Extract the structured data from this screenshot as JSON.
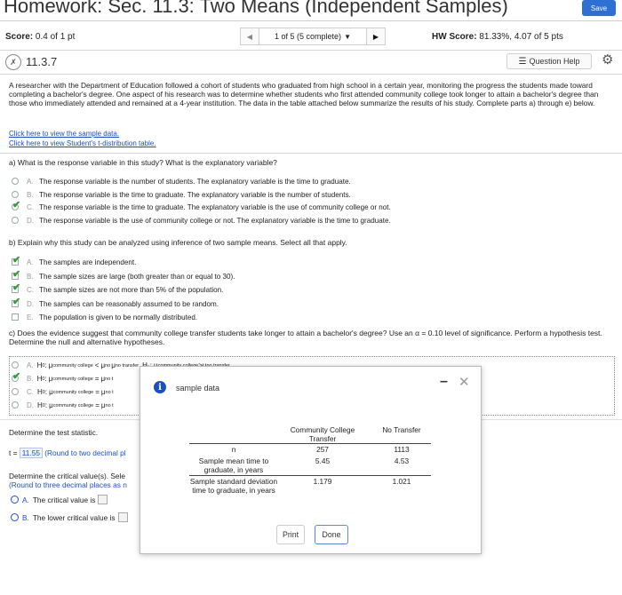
{
  "header": {
    "title": "Homework: Sec. 11.3: Two Means (Independent Samples)",
    "save_label": "Save",
    "score_label": "Score:",
    "score_value": "0.4 of 1 pt",
    "nav_prev": "◀",
    "nav_selector": "1 of 5 (5 complete)",
    "nav_next": "▶",
    "hw_score_label": "HW Score:",
    "hw_score_value": "81.33%, 4.07 of 5 pts"
  },
  "question": {
    "id": "11.3.7",
    "help_label": "Question Help",
    "intro": "A researcher with the Department of Education followed a cohort of students who graduated from high school in a certain year, monitoring the progress the students made toward completing a bachelor's degree. One aspect of his research was to determine whether students who first attended community college took longer to attain a bachelor's degree than those who immediately attended and remained at a 4-year institution. The data in the table attached below summarize the results of his study. Complete parts a) through e) below.",
    "link_data": "Click here to view the sample data.",
    "link_table": "Click here to view Student's t-distribution table."
  },
  "part_a": {
    "prompt": "a) What is the response variable in this study? What is the explanatory variable?",
    "options": [
      {
        "letter": "A.",
        "text": "The response variable is the number of students. The explanatory variable is the time to graduate.",
        "checked": false
      },
      {
        "letter": "B.",
        "text": "The response variable is the time to graduate. The explanatory variable is the number of students.",
        "checked": false
      },
      {
        "letter": "C.",
        "text": "The response variable is the time to graduate. The explanatory variable is the use of community college or not.",
        "checked": true
      },
      {
        "letter": "D.",
        "text": "The response variable is the use of community college or not. The explanatory variable is the time to graduate.",
        "checked": false
      }
    ]
  },
  "part_b": {
    "prompt": "b) Explain why this study can be analyzed using inference of two sample means. Select all that apply.",
    "options": [
      {
        "letter": "A.",
        "text": "The samples are independent.",
        "checked": true
      },
      {
        "letter": "B.",
        "text": "The sample sizes are large (both greater than or equal to 30).",
        "checked": true
      },
      {
        "letter": "C.",
        "text": "The sample sizes are not more than 5% of the population.",
        "checked": true
      },
      {
        "letter": "D.",
        "text": "The samples can be reasonably assumed to be random.",
        "checked": true
      },
      {
        "letter": "E.",
        "text": "The population is given to be normally distributed.",
        "checked": false
      }
    ]
  },
  "part_c": {
    "prompt": "c) Does the evidence suggest that community college transfer students take longer to attain a bachelor's degree? Use an α = 0.10 level of significance. Perform a hypothesis test. Determine the null and alternative hypotheses.",
    "options": [
      {
        "letter": "A.",
        "h": "H",
        "zero": "0",
        "colon": ":",
        "mu": "μ",
        "sub1": "community college",
        "op": "<",
        "sub2": "no",
        "tail": "μ",
        "tail_sub": "no transfer",
        "h1": "H₁: μ",
        "h1_sub": "community college",
        "h1_op": ">",
        "h1_sub2": "no transfer",
        "checked": false
      },
      {
        "letter": "B.",
        "h": "H",
        "zero": "0",
        "colon": ":",
        "mu": "μ",
        "sub1": "community college",
        "op": "=",
        "sub2": "no t",
        "checked": true
      },
      {
        "letter": "C.",
        "h": "H",
        "zero": "0",
        "colon": ":",
        "mu": "μ",
        "sub1": "community college",
        "op": "=",
        "sub2": "no t",
        "checked": false
      },
      {
        "letter": "D.",
        "h": "H",
        "zero": "0",
        "colon": ":",
        "mu": "μ",
        "sub1": "community college",
        "op": "=",
        "sub2": "no t",
        "checked": false
      }
    ]
  },
  "part_d": {
    "test_stat_prompt": "Determine the test statistic.",
    "t_prefix": "t =",
    "t_value": "11.55",
    "t_hint": "(Round to two decimal pl",
    "crit_prompt": "Determine the critical value(s). Sele",
    "crit_hint": "(Round to three decimal places as n",
    "opt_a_letter": "A.",
    "opt_a_text": "The critical value is",
    "opt_b_letter": "B.",
    "opt_b_text": "The lower critical value is"
  },
  "dialog": {
    "title": "sample data",
    "col_cc": "Community College",
    "col_cc2": "Transfer",
    "col_nt": "No Transfer",
    "rows": [
      {
        "label": "n",
        "cc": "257",
        "nt": "1113"
      },
      {
        "label": "Sample mean time to graduate, in years",
        "cc": "5.45",
        "nt": "4.53"
      },
      {
        "label": "Sample standard deviation time to graduate, in years",
        "cc": "1.179",
        "nt": "1.021"
      }
    ],
    "print_label": "Print",
    "done_label": "Done"
  },
  "colors": {
    "accent": "#2d6fd2",
    "link": "#1b4fc9",
    "check": "#2f9a2f"
  }
}
